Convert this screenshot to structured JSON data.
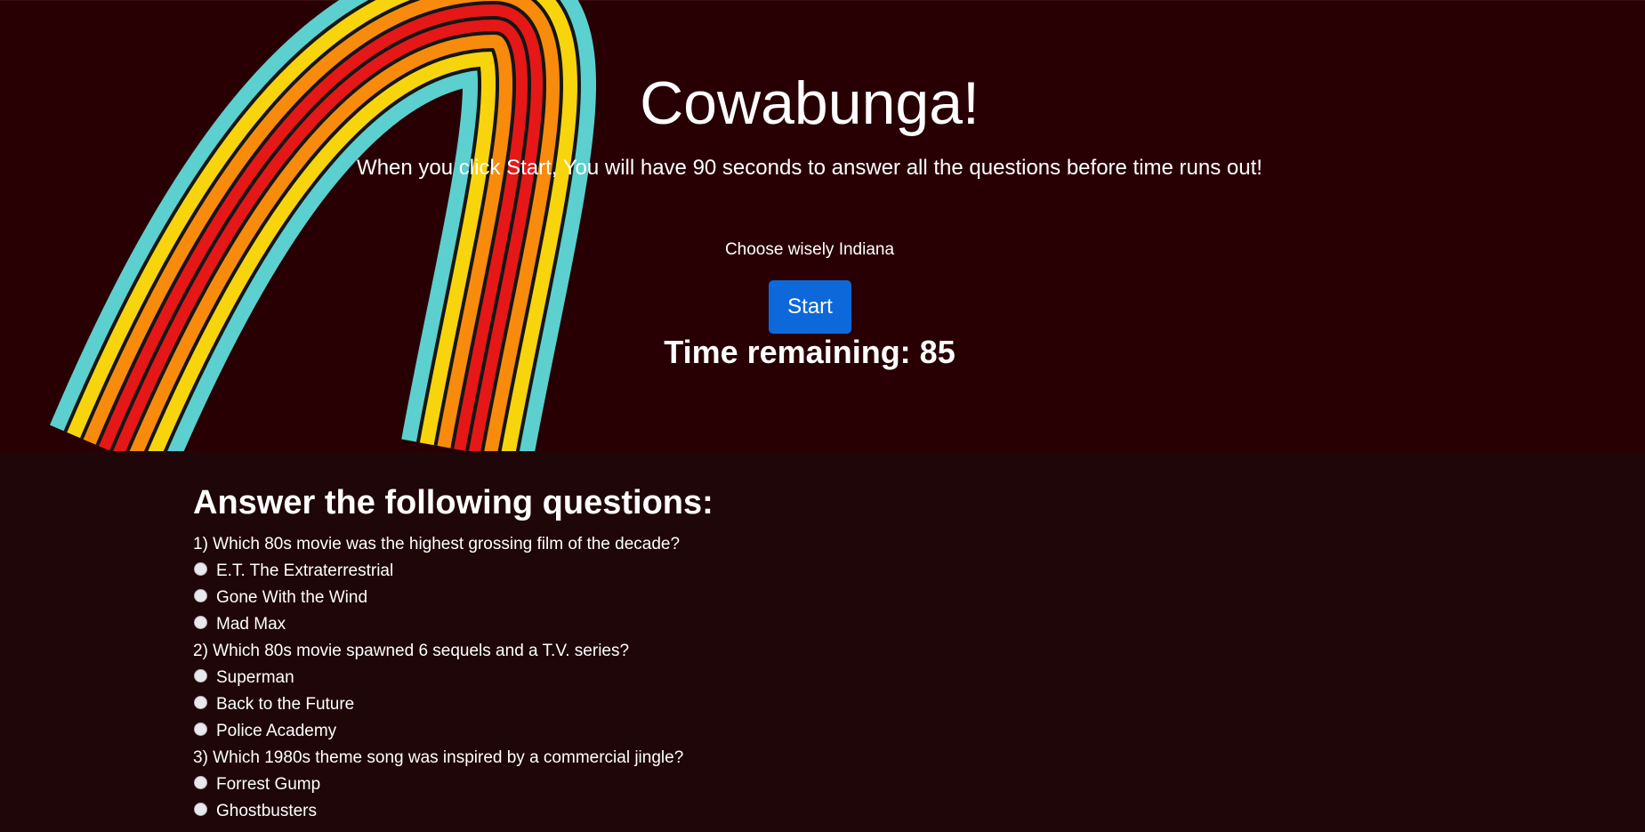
{
  "header": {
    "title": "Cowabunga!",
    "subtitle": "When you click Start, You will have 90 seconds to answer all the questions before time runs out!",
    "tagline": "Choose wisely Indiana",
    "start_label": "Start",
    "timer_text": "Time remaining: 85"
  },
  "colors": {
    "hero_background": "#280003",
    "page_background": "#1f0608",
    "button": "#0d68d9",
    "rainbow": [
      "#5ccfcf",
      "#f7d40c",
      "#f88b0b",
      "#e61717"
    ]
  },
  "quiz": {
    "heading": "Answer the following questions:",
    "questions": [
      {
        "text": "1) Which 80s movie was the highest grossing film of the decade?",
        "options": [
          "E.T. The Extraterrestrial",
          "Gone With the Wind",
          "Mad Max"
        ]
      },
      {
        "text": "2) Which 80s movie spawned 6 sequels and a T.V. series?",
        "options": [
          "Superman",
          "Back to the Future",
          "Police Academy"
        ]
      },
      {
        "text": "3) Which 1980s theme song was inspired by a commercial jingle?",
        "options": [
          "Forrest Gump",
          "Ghostbusters"
        ]
      }
    ]
  }
}
